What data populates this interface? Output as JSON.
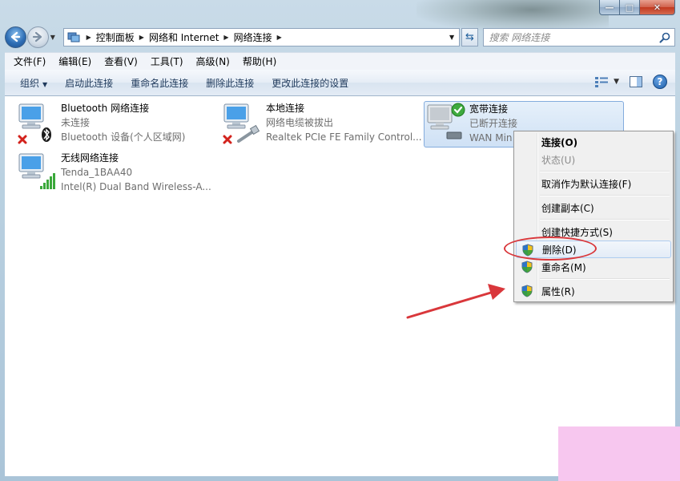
{
  "nav": {
    "breadcrumbs": [
      "控制面板",
      "网络和 Internet",
      "网络连接"
    ],
    "search_placeholder": "搜索 网络连接"
  },
  "menubar": {
    "items": [
      "文件(F)",
      "编辑(E)",
      "查看(V)",
      "工具(T)",
      "高级(N)",
      "帮助(H)"
    ]
  },
  "cmdbar": {
    "organize": "组织",
    "items": [
      "启动此连接",
      "重命名此连接",
      "删除此连接",
      "更改此连接的设置"
    ]
  },
  "connections": [
    {
      "name": "Bluetooth 网络连接",
      "status": "未连接",
      "device": "Bluetooth 设备(个人区域网)"
    },
    {
      "name": "本地连接",
      "status": "网络电缆被拔出",
      "device": "Realtek PCIe FE Family Control..."
    },
    {
      "name": "宽带连接",
      "status": "已断开连接",
      "device": "WAN Min"
    },
    {
      "name": "无线网络连接",
      "status": "Tenda_1BAA40",
      "device": "Intel(R) Dual Band Wireless-A..."
    }
  ],
  "context_menu": {
    "connect": "连接(O)",
    "status": "状态(U)",
    "cancel_default": "取消作为默认连接(F)",
    "create_copy": "创建副本(C)",
    "create_shortcut": "创建快捷方式(S)",
    "delete": "删除(D)",
    "rename": "重命名(M)",
    "properties": "属性(R)"
  },
  "colors": {
    "annotation": "#d9373b",
    "selection_border": "#84acdd",
    "link_text": "#1e395b"
  }
}
